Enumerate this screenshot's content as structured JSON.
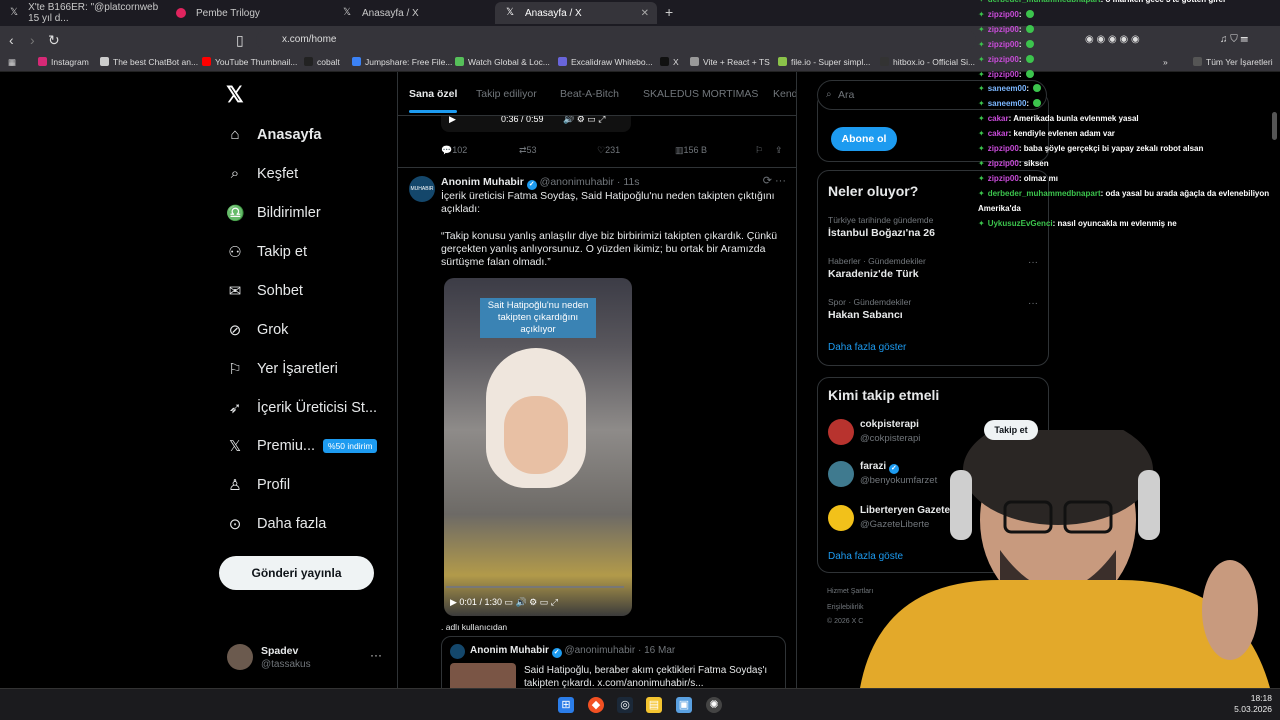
{
  "browser": {
    "tabs": [
      {
        "title": "X'te B166ER: \"@platcornweb 15 yıl d..."
      },
      {
        "title": "Pembe Trilogy"
      },
      {
        "title": "Anasayfa / X"
      },
      {
        "title": "Anasayfa / X"
      }
    ],
    "url": "x.com/home",
    "bookmarks": [
      "Instagram",
      "The best ChatBot an...",
      "YouTube Thumbnail...",
      "cobalt",
      "Jumpshare: Free File...",
      "Watch Global & Loc...",
      "Excalidraw Whitebo...",
      "X",
      "Vite + React + TS",
      "file.io - Super simpl...",
      "hitbox.io - Official Si..."
    ],
    "all_bookmarks": "Tüm Yer İşaretleri"
  },
  "sidebar": {
    "items": [
      {
        "label": "Anasayfa",
        "icon": "home-icon"
      },
      {
        "label": "Keşfet",
        "icon": "search-icon"
      },
      {
        "label": "Bildirimler",
        "icon": "bell-icon"
      },
      {
        "label": "Takip et",
        "icon": "person-add-icon"
      },
      {
        "label": "Sohbet",
        "icon": "mail-icon"
      },
      {
        "label": "Grok",
        "icon": "grok-icon"
      },
      {
        "label": "Yer İşaretleri",
        "icon": "bookmark-icon"
      },
      {
        "label": "İçerik Üreticisi St...",
        "icon": "rocket-icon"
      },
      {
        "label": "Premiu...",
        "icon": "x-premium-icon",
        "badge": "%50 indirim"
      },
      {
        "label": "Profil",
        "icon": "person-icon"
      },
      {
        "label": "Daha fazla",
        "icon": "more-circle-icon"
      }
    ],
    "post_button": "Gönderi yayınla",
    "account": {
      "name": "Spadev",
      "handle": "@tassakus"
    }
  },
  "feed": {
    "tabs": [
      "Sana özel",
      "Takip ediliyor",
      "Beat-A-Bitch",
      "SKALEDUS MORTIMAS",
      "Kend"
    ],
    "prev_video_time": "0:36 / 0:59",
    "prev_actions": {
      "replies": "102",
      "reposts": "53",
      "likes": "231",
      "views": "156 B"
    },
    "post": {
      "name": "Anonim Muhabir",
      "handle": "@anonimuhabir",
      "time": "11s",
      "text1": "İçerik üreticisi Fatma Soydaş, Said Hatipoğlu'nu neden takipten çıktığını açıkladı:",
      "text2": "“Takip konusu yanlış anlaşılır diye biz birbirimizi takipten çıkardık. Çünkü gerçekten yanlış anlıyorsunuz. O yüzden ikimiz; bu ortak bir Aramızda sürtüşme falan olmadı.”",
      "video_caption": "Sait Hatipoğlu'nu neden takipten çıkardığını açıklıyor",
      "video_time": "0:01 / 1:30",
      "source": ". adlı kullanıcıdan",
      "quote": {
        "name": "Anonim Muhabir",
        "handle": "@anonimuhabir",
        "date": "16 Mar",
        "text": "Said Hatipoğlu, beraber akım çektikleri Fatma Soydaş'ı takipten çıkardı.  x.com/anonimuhabir/s..."
      }
    }
  },
  "right": {
    "search_placeholder": "Ara",
    "subscribe": "Abone ol",
    "trends_title": "Neler oluyor?",
    "trends": [
      {
        "sub": "Türkiye tarihinde gündemde",
        "name": "İstanbul Boğazı'na 26"
      },
      {
        "sub": "Haberler · Gündemdekiler",
        "name": "Karadeniz'de Türk"
      },
      {
        "sub": "Spor · Gündemdekiler",
        "name": "Hakan Sabancı"
      }
    ],
    "show_more": "Daha fazla göster",
    "who_title": "Kimi takip etmeli",
    "who": [
      {
        "name": "cokpisterapi",
        "handle": "@cokpisterapi"
      },
      {
        "name": "farazi",
        "handle": "@benyokumfarzet"
      },
      {
        "name": "Liberteryen Gazete",
        "handle": "@GazeteLiberte"
      }
    ],
    "follow": "Takip et",
    "show_more2": "Daha fazla göste",
    "footer": [
      "Hizmet Şartları",
      "Erişilebilirlik",
      "© 2026 X C"
    ]
  },
  "chat": [
    {
      "user": "derbeder_muhammedbnapart",
      "msg": ": o mariken gece 3'te gotten girer",
      "color": "#3cc44d"
    },
    {
      "user": "zipzip00",
      "msg": ":",
      "color": "#c84bd8",
      "emote": true
    },
    {
      "user": "zipzip00",
      "msg": ":",
      "color": "#c84bd8",
      "emote": true
    },
    {
      "user": "zipzip00",
      "msg": ":",
      "color": "#c84bd8",
      "emote": true
    },
    {
      "user": "zipzip00",
      "msg": ":",
      "color": "#c84bd8",
      "emote": true
    },
    {
      "user": "zipzip00",
      "msg": ":",
      "color": "#c84bd8",
      "emote": true
    },
    {
      "user": "saneem00",
      "msg": ":",
      "color": "#7cb7ff",
      "emote": true
    },
    {
      "user": "saneem00",
      "msg": ":",
      "color": "#7cb7ff",
      "emote": true
    },
    {
      "user": "cakar",
      "msg": ": Amerikada bunla evlenmek yasal",
      "color": "#c84bd8"
    },
    {
      "user": "cakar",
      "msg": ": kendiyle evlenen adam var",
      "color": "#c84bd8"
    },
    {
      "user": "zipzip00",
      "msg": ": baba şöyle gerçekçi bi yapay zekalı robot alsan",
      "color": "#c84bd8"
    },
    {
      "user": "zipzip00",
      "msg": ": siksen",
      "color": "#c84bd8"
    },
    {
      "user": "zipzip00",
      "msg": ": olmaz mı",
      "color": "#c84bd8"
    },
    {
      "user": "derbeder_muhammedbnapart",
      "msg": ": oda yasal bu arada ağaçla da evlenebiliyon",
      "color": "#3cc44d"
    },
    {
      "user": "",
      "msg": "Amerika'da",
      "color": "#fff"
    },
    {
      "user": "UykusuzEvGenci",
      "msg": ": nasıl oyuncakla mı evlenmiş ne",
      "color": "#3cc44d"
    }
  ],
  "taskbar": {
    "time": "18:18",
    "date": "5.03.2026"
  }
}
